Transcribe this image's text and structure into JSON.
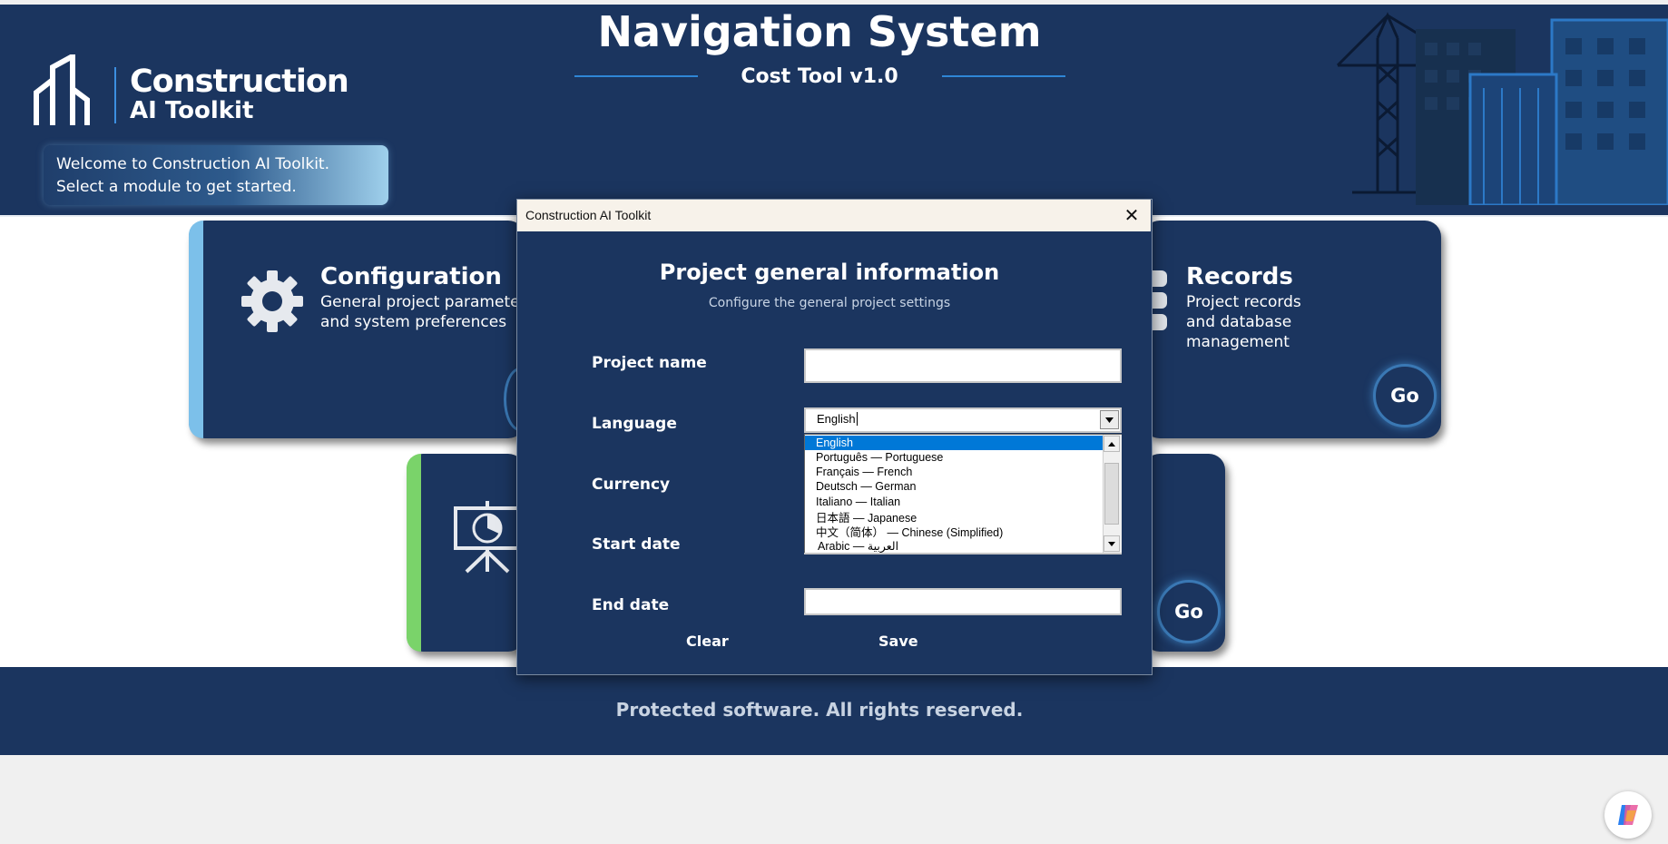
{
  "header": {
    "logo_line1": "Construction",
    "logo_line2": "AI Toolkit",
    "welcome_line1": "Welcome to Construction AI Toolkit.",
    "welcome_line2": "Select a module to get started.",
    "title": "Navigation System",
    "subtitle": "Cost Tool v1.0"
  },
  "modules": {
    "configuration": {
      "title": "Configuration",
      "desc_line1": "General project parameters",
      "desc_line2": "and system preferences",
      "icon": "gear-icon",
      "accent_color": "#7cc0ea"
    },
    "records": {
      "title": "Records",
      "desc_line1": "Project records",
      "desc_line2": "and database",
      "desc_line3": "management",
      "icon": "database-icon",
      "go_label": "Go"
    },
    "reports": {
      "icon": "presentation-chart-icon",
      "accent_color": "#7ad36a",
      "go_label": "Go"
    }
  },
  "footer": {
    "text": "Protected software. All rights reserved."
  },
  "dialog": {
    "window_title": "Construction AI Toolkit",
    "heading": "Project general information",
    "subheading": "Configure the general project settings",
    "labels": {
      "project_name": "Project name",
      "language": "Language",
      "currency": "Currency",
      "start_date": "Start date",
      "end_date": "End date"
    },
    "project_name_value": "",
    "end_date_value": "",
    "language_value": "English",
    "language_options": [
      "English",
      "Português — Portuguese",
      "Français — French",
      "Deutsch — German",
      "Italiano — Italian",
      "日本語 — Japanese",
      "中文（简体） — Chinese (Simplified)",
      "Arabic — العربية"
    ],
    "selected_option_index": 0,
    "clear_label": "Clear",
    "save_label": "Save"
  },
  "colors": {
    "navy": "#1b355f",
    "selection": "#0078d7",
    "accent_line": "#2f86d6"
  }
}
